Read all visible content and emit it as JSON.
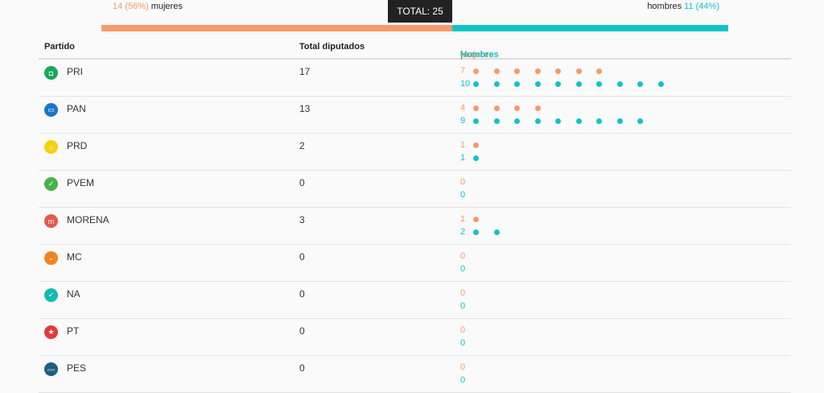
{
  "summary": {
    "women_pct": "14 (56%)",
    "women_label": "mujeres",
    "total": "TOTAL: 25",
    "men_label": "hombres",
    "men_pct": "11 (44%)",
    "women_fraction": 0.56,
    "men_fraction": 0.44
  },
  "table": {
    "header_party": "Partido",
    "header_total": "Total diputados",
    "header_women": "Mujeres",
    "header_sep": "|",
    "header_men": "Hombres",
    "rows": [
      {
        "party": "PRI",
        "total": "17",
        "women": "7",
        "men": "10",
        "logo_icon": "pri-logo-icon",
        "logo_color": "#16a95a",
        "logo_glyph": "◘"
      },
      {
        "party": "PAN",
        "total": "13",
        "women": "4",
        "men": "9",
        "logo_icon": "pan-logo-icon",
        "logo_color": "#1b74c8",
        "logo_glyph": "▭"
      },
      {
        "party": "PRD",
        "total": "2",
        "women": "1",
        "men": "1",
        "logo_icon": "prd-sun-logo-icon",
        "logo_color": "#f5d10b",
        "logo_glyph": "☼"
      },
      {
        "party": "PVEM",
        "total": "0",
        "women": "0",
        "men": "0",
        "logo_icon": "pvem-toucan-logo-icon",
        "logo_color": "#47b34d",
        "logo_glyph": "✓"
      },
      {
        "party": "MORENA",
        "total": "3",
        "women": "1",
        "men": "2",
        "logo_icon": "morena-logo-icon",
        "logo_color": "#e55a4e",
        "logo_glyph": "m"
      },
      {
        "party": "MC",
        "total": "0",
        "women": "0",
        "men": "0",
        "logo_icon": "mc-eagle-logo-icon",
        "logo_color": "#f58220",
        "logo_glyph": "⌄"
      },
      {
        "party": "NA",
        "total": "0",
        "women": "0",
        "men": "0",
        "logo_icon": "na-logo-icon",
        "logo_color": "#14b8b5",
        "logo_glyph": "✓"
      },
      {
        "party": "PT",
        "total": "0",
        "women": "0",
        "men": "0",
        "logo_icon": "pt-star-logo-icon",
        "logo_color": "#e23b3b",
        "logo_glyph": "★"
      },
      {
        "party": "PES",
        "total": "0",
        "women": "0",
        "men": "0",
        "logo_icon": "pes-logo-icon",
        "logo_color": "#1d5f84",
        "logo_glyph": "◦◦◦"
      }
    ]
  },
  "colors": {
    "women": "#f79a6b",
    "men": "#0fc4c8",
    "badge_bg": "#222222"
  }
}
